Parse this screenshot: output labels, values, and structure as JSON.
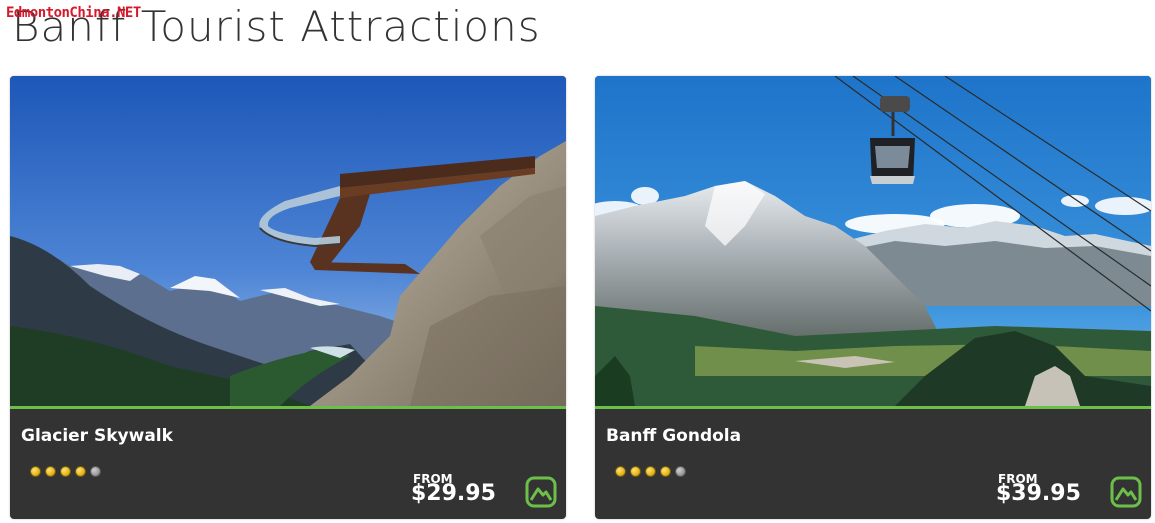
{
  "watermark": "EdmontonChina.NET",
  "page_title": "Banff Tourist Attractions",
  "colors": {
    "accent": "#6cc04a",
    "card_bg": "#333333",
    "star_on": "#f2c21b",
    "star_off": "#9a9a9a"
  },
  "cards": [
    {
      "title": "Glacier Skywalk",
      "image": "glacier-skywalk-photo",
      "rating": 4,
      "rating_max": 5,
      "from_label": "FROM",
      "price": "$29.95",
      "icon": "mountain-icon"
    },
    {
      "title": "Banff Gondola",
      "image": "banff-gondola-photo",
      "rating": 4,
      "rating_max": 5,
      "from_label": "FROM",
      "price": "$39.95",
      "icon": "mountain-icon"
    }
  ]
}
